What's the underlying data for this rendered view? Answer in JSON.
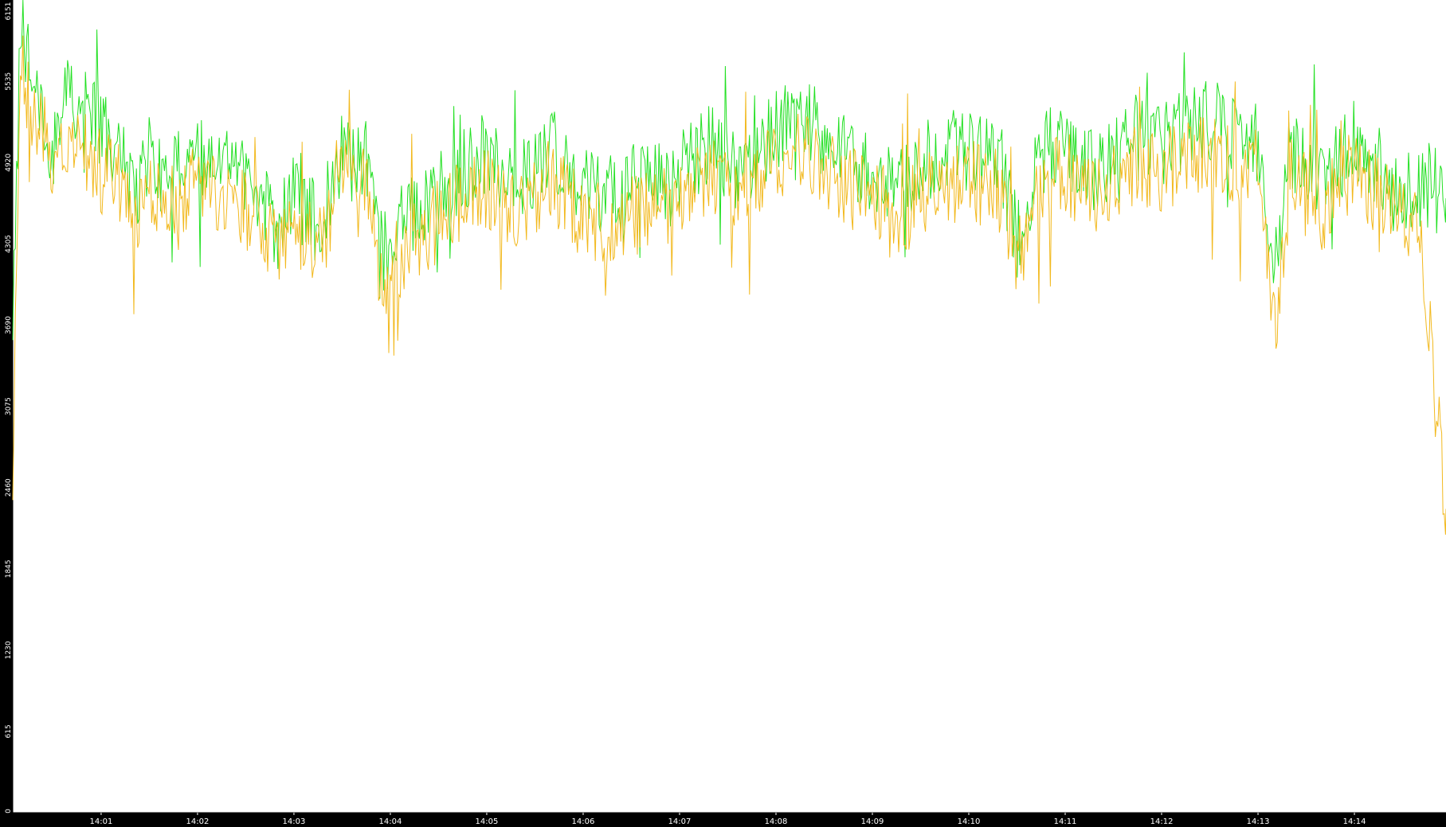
{
  "chart_data": {
    "type": "line",
    "title": "",
    "xlabel": "",
    "ylabel": "",
    "ylim": [
      0,
      6151
    ],
    "y_ticks": [
      "0",
      "615",
      "1230",
      "1845",
      "2460",
      "3075",
      "3690",
      "4305",
      "4920",
      "5535",
      "6151"
    ],
    "x_ticks": [
      "14:01",
      "14:02",
      "14:03",
      "14:04",
      "14:05",
      "14:06",
      "14:07",
      "14:08",
      "14:09",
      "14:10",
      "14:11",
      "14:12",
      "14:13",
      "14:14"
    ],
    "x_range": [
      "14:00:05",
      "14:14:57"
    ],
    "grid": false,
    "legend": "none",
    "background": "#ffffff",
    "axis_color": "#000000",
    "series": [
      {
        "color": "#22e022",
        "points": [
          [
            "14:00:05",
            3800
          ],
          [
            "14:00:10",
            5900
          ],
          [
            "14:00:15",
            5650
          ],
          [
            "14:00:20",
            5450
          ],
          [
            "14:00:25",
            5300
          ],
          [
            "14:00:30",
            5000
          ],
          [
            "14:00:40",
            5450
          ],
          [
            "14:00:50",
            5350
          ],
          [
            "14:01:00",
            5150
          ],
          [
            "14:01:10",
            5050
          ],
          [
            "14:01:20",
            4700
          ],
          [
            "14:01:30",
            4950
          ],
          [
            "14:01:40",
            4800
          ],
          [
            "14:02:00",
            5000
          ],
          [
            "14:02:20",
            4900
          ],
          [
            "14:02:40",
            4650
          ],
          [
            "14:02:50",
            4400
          ],
          [
            "14:03:00",
            4700
          ],
          [
            "14:03:15",
            4450
          ],
          [
            "14:03:30",
            5000
          ],
          [
            "14:03:45",
            4950
          ],
          [
            "14:03:55",
            4200
          ],
          [
            "14:04:05",
            4450
          ],
          [
            "14:04:20",
            4600
          ],
          [
            "14:04:40",
            4800
          ],
          [
            "14:05:00",
            5000
          ],
          [
            "14:05:20",
            4750
          ],
          [
            "14:05:40",
            5050
          ],
          [
            "14:06:00",
            4700
          ],
          [
            "14:06:20",
            4650
          ],
          [
            "14:06:40",
            4750
          ],
          [
            "14:07:00",
            4850
          ],
          [
            "14:07:20",
            5050
          ],
          [
            "14:07:40",
            4800
          ],
          [
            "14:08:00",
            5200
          ],
          [
            "14:08:20",
            5250
          ],
          [
            "14:08:40",
            5000
          ],
          [
            "14:09:00",
            4800
          ],
          [
            "14:09:20",
            4750
          ],
          [
            "14:09:40",
            5000
          ],
          [
            "14:10:00",
            5000
          ],
          [
            "14:10:20",
            4900
          ],
          [
            "14:10:30",
            4350
          ],
          [
            "14:10:45",
            5000
          ],
          [
            "14:11:00",
            5050
          ],
          [
            "14:11:20",
            4850
          ],
          [
            "14:11:40",
            5100
          ],
          [
            "14:12:00",
            5050
          ],
          [
            "14:12:20",
            5250
          ],
          [
            "14:12:40",
            5200
          ],
          [
            "14:13:00",
            5050
          ],
          [
            "14:13:10",
            4100
          ],
          [
            "14:13:20",
            5000
          ],
          [
            "14:13:40",
            4750
          ],
          [
            "14:14:00",
            5100
          ],
          [
            "14:14:20",
            4800
          ],
          [
            "14:14:40",
            4700
          ],
          [
            "14:14:57",
            4650
          ]
        ]
      },
      {
        "color": "#f2b91e",
        "points": [
          [
            "14:00:05",
            2500
          ],
          [
            "14:00:10",
            5700
          ],
          [
            "14:00:15",
            5400
          ],
          [
            "14:00:20",
            5200
          ],
          [
            "14:00:25",
            5100
          ],
          [
            "14:00:30",
            4800
          ],
          [
            "14:00:40",
            5100
          ],
          [
            "14:00:50",
            5000
          ],
          [
            "14:01:00",
            4850
          ],
          [
            "14:01:10",
            4800
          ],
          [
            "14:01:20",
            4500
          ],
          [
            "14:01:30",
            4700
          ],
          [
            "14:01:40",
            4600
          ],
          [
            "14:02:00",
            4750
          ],
          [
            "14:02:20",
            4650
          ],
          [
            "14:02:40",
            4450
          ],
          [
            "14:02:50",
            4200
          ],
          [
            "14:03:00",
            4500
          ],
          [
            "14:03:15",
            4250
          ],
          [
            "14:03:30",
            4800
          ],
          [
            "14:03:45",
            4700
          ],
          [
            "14:03:55",
            3900
          ],
          [
            "14:04:05",
            4200
          ],
          [
            "14:04:20",
            4350
          ],
          [
            "14:04:40",
            4600
          ],
          [
            "14:05:00",
            4750
          ],
          [
            "14:05:20",
            4550
          ],
          [
            "14:05:40",
            4800
          ],
          [
            "14:06:00",
            4500
          ],
          [
            "14:06:20",
            4450
          ],
          [
            "14:06:40",
            4550
          ],
          [
            "14:07:00",
            4650
          ],
          [
            "14:07:20",
            4850
          ],
          [
            "14:07:40",
            4600
          ],
          [
            "14:08:00",
            4950
          ],
          [
            "14:08:20",
            5000
          ],
          [
            "14:08:40",
            4800
          ],
          [
            "14:09:00",
            4600
          ],
          [
            "14:09:20",
            4550
          ],
          [
            "14:09:40",
            4750
          ],
          [
            "14:10:00",
            4800
          ],
          [
            "14:10:20",
            4700
          ],
          [
            "14:10:30",
            4150
          ],
          [
            "14:10:45",
            4800
          ],
          [
            "14:11:00",
            4850
          ],
          [
            "14:11:20",
            4650
          ],
          [
            "14:11:40",
            4900
          ],
          [
            "14:12:00",
            4850
          ],
          [
            "14:12:20",
            5000
          ],
          [
            "14:12:40",
            4950
          ],
          [
            "14:13:00",
            4850
          ],
          [
            "14:13:10",
            3600
          ],
          [
            "14:13:20",
            4800
          ],
          [
            "14:13:40",
            4550
          ],
          [
            "14:14:00",
            4900
          ],
          [
            "14:14:20",
            4600
          ],
          [
            "14:14:40",
            4500
          ],
          [
            "14:14:57",
            2300
          ]
        ]
      }
    ]
  }
}
